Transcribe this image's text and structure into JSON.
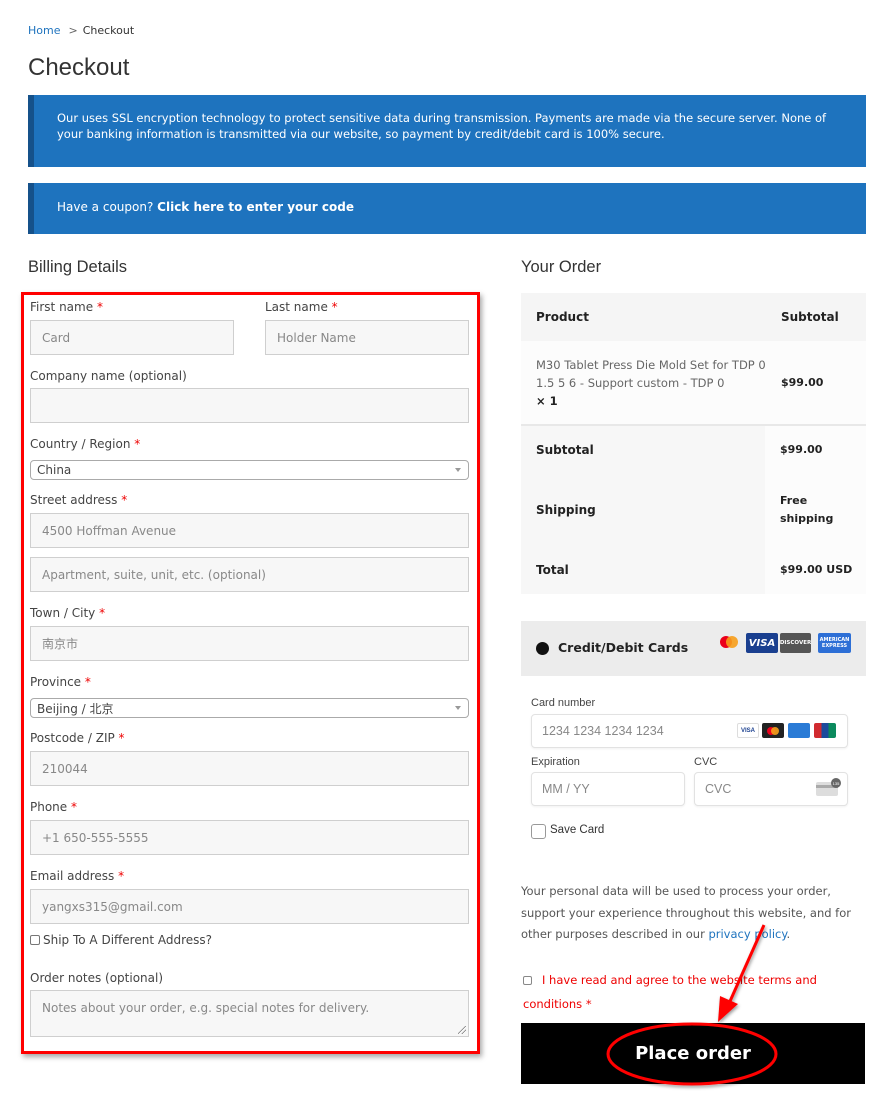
{
  "breadcrumb": {
    "home": "Home",
    "separator": ">",
    "current": "Checkout"
  },
  "page_title": "Checkout",
  "notices": {
    "ssl": "Our uses SSL encryption technology to protect sensitive data during transmission. Payments are made via the secure server. None of your banking information is transmitted via our website, so payment by credit/debit card is 100% secure.",
    "coupon_prefix": "Have a coupon?",
    "coupon_link": "Click here to enter your code"
  },
  "billing": {
    "title": "Billing Details",
    "required_mark": "*",
    "fields": {
      "first_name": {
        "label": "First name",
        "value": "Card"
      },
      "last_name": {
        "label": "Last name",
        "value": "Holder Name"
      },
      "company": {
        "label": "Company name (optional)",
        "value": ""
      },
      "country": {
        "label": "Country / Region",
        "value": "China"
      },
      "street": {
        "label": "Street address",
        "value": "4500 Hoffman Avenue",
        "placeholder2": "Apartment, suite, unit, etc. (optional)"
      },
      "city": {
        "label": "Town / City",
        "value": "南京市"
      },
      "province": {
        "label": "Province",
        "value": "Beijing / 北京"
      },
      "postcode": {
        "label": "Postcode / ZIP",
        "value": "210044"
      },
      "phone": {
        "label": "Phone",
        "value": "+1 650-555-5555"
      },
      "email": {
        "label": "Email address",
        "value": "yangxs315@gmail.com"
      },
      "ship_different": {
        "label": "Ship To A Different Address?",
        "checked": false
      },
      "order_notes": {
        "label": "Order notes (optional)",
        "placeholder": "Notes about your order, e.g. special notes for delivery."
      }
    }
  },
  "order": {
    "title": "Your Order",
    "headers": {
      "product": "Product",
      "subtotal": "Subtotal"
    },
    "items": [
      {
        "name": "M30 Tablet Press Die Mold Set for TDP 0 1.5 5 6 - Support custom - TDP 0",
        "qty": "× 1",
        "price": "$99.00"
      }
    ],
    "totals": [
      {
        "label": "Subtotal",
        "value": "$99.00"
      },
      {
        "label": "Shipping",
        "value": "Free shipping"
      },
      {
        "label": "Total",
        "value": "$99.00 USD"
      }
    ]
  },
  "payment": {
    "method": "Credit/Debit Cards",
    "brands": [
      "mastercard",
      "VISA",
      "DISCOVER",
      "AMERICAN EXPRESS"
    ],
    "card_number": {
      "label": "Card number",
      "placeholder": "1234 1234 1234 1234"
    },
    "card_brands_small": [
      "VISA",
      "mastercard",
      "amex",
      "UnionPay"
    ],
    "expiration": {
      "label": "Expiration",
      "placeholder": "MM / YY"
    },
    "cvc": {
      "label": "CVC",
      "placeholder": "CVC",
      "badge": "135"
    },
    "save_card": "Save Card"
  },
  "privacy": {
    "text": "Your personal data will be used to process your order, support your experience throughout this website, and for other purposes described in our",
    "link": "privacy policy",
    "end": "."
  },
  "terms": {
    "text": "I have read and agree to the website terms and conditions",
    "required_mark": "*"
  },
  "place_order": "Place order",
  "colors": {
    "accent": "#1e73be",
    "notice_border": "#15518a",
    "required": "#ee0000",
    "annotation": "#ff0000",
    "button": "#000000"
  }
}
